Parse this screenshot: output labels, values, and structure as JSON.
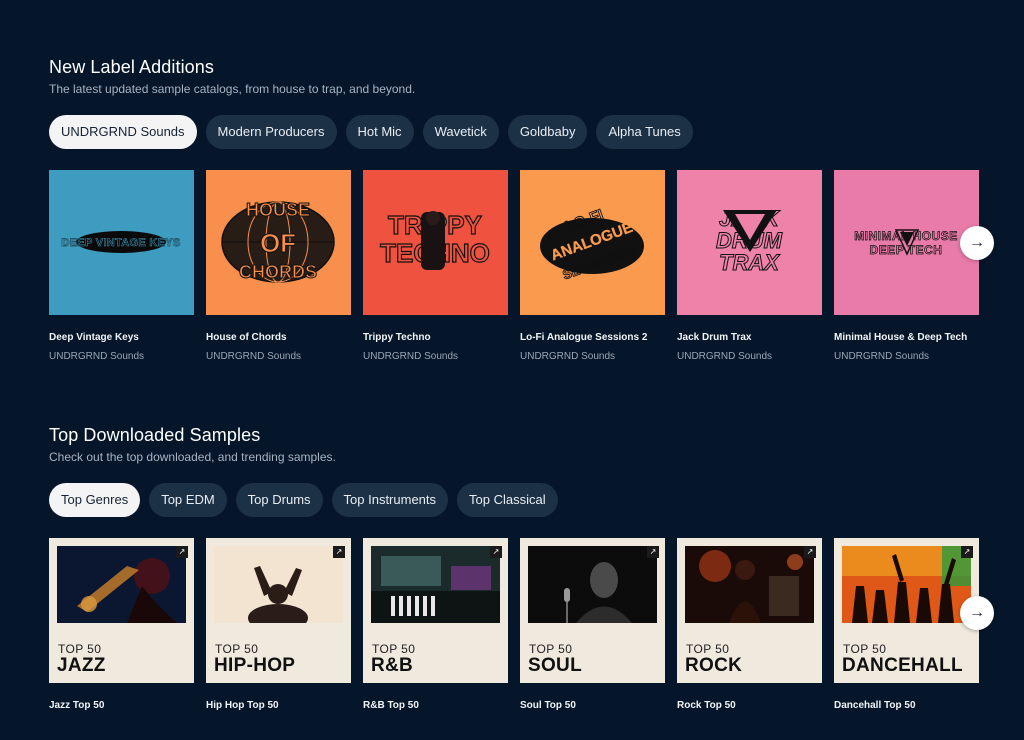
{
  "label_section": {
    "title": "New Label Additions",
    "subtitle": "The latest updated sample catalogs, from house to trap, and beyond.",
    "pills": [
      "UNDRGRND Sounds",
      "Modern Producers",
      "Hot Mic",
      "Wavetick",
      "Goldbaby",
      "Alpha Tunes"
    ],
    "cards": [
      {
        "title": "Deep Vintage Keys",
        "subtitle": "UNDRGRND Sounds",
        "art_text": "DEEP VINTAGE KEYS",
        "color": "#3d9cc0"
      },
      {
        "title": "House of Chords",
        "subtitle": "UNDRGRND Sounds",
        "art_text": "HOUSE OF CHORDS",
        "color": "#f98f4c"
      },
      {
        "title": "Trippy Techno",
        "subtitle": "UNDRGRND Sounds",
        "art_text": "TRIPPY TECHNO",
        "color": "#ef5340"
      },
      {
        "title": "Lo-Fi Analogue Sessions 2",
        "subtitle": "UNDRGRND Sounds",
        "art_text": "LO-FI ANALOGUE SESSIONS 2",
        "color": "#f99a4f"
      },
      {
        "title": "Jack Drum Trax",
        "subtitle": "UNDRGRND Sounds",
        "art_text": "JACK DRUM TRAX",
        "color": "#ee82a9"
      },
      {
        "title": "Minimal House & Deep Tech",
        "subtitle": "UNDRGRND Sounds",
        "art_text": "MINIMAL HOUSE DEEP TECH",
        "color": "#e97ba8"
      }
    ]
  },
  "samples_section": {
    "title": "Top Downloaded Samples",
    "subtitle": "Check out the top downloaded, and trending samples.",
    "pills": [
      "Top Genres",
      "Top EDM",
      "Top Drums",
      "Top Instruments",
      "Top Classical"
    ],
    "cards": [
      {
        "title": "Jazz Top 50",
        "top": "TOP 50",
        "genre": "JAZZ"
      },
      {
        "title": "Hip Hop Top 50",
        "top": "TOP 50",
        "genre": "HIP-HOP"
      },
      {
        "title": "R&B Top 50",
        "top": "TOP 50",
        "genre": "R&B"
      },
      {
        "title": "Soul Top 50",
        "top": "TOP 50",
        "genre": "SOUL"
      },
      {
        "title": "Rock Top 50",
        "top": "TOP 50",
        "genre": "ROCK"
      },
      {
        "title": "Dancehall Top 50",
        "top": "TOP 50",
        "genre": "DANCEHALL"
      }
    ]
  },
  "icons": {
    "next_arrow": "→",
    "external_link": "↗"
  }
}
